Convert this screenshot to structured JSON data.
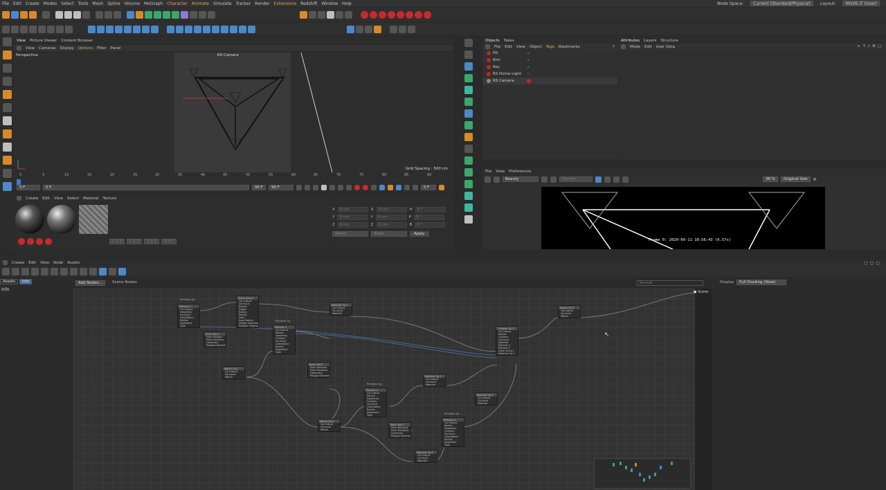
{
  "menu": [
    "File",
    "Edit",
    "Create",
    "Modes",
    "Select",
    "Tools",
    "Mesh",
    "Spline",
    "Volume",
    "MoGraph",
    "Character",
    "Animate",
    "Simulate",
    "Tracker",
    "Render",
    "Extensions",
    "Redshift",
    "Window",
    "Help"
  ],
  "menu_highlight": [
    "Character",
    "Animate",
    "Extensions"
  ],
  "node_space_label": "Node Space:",
  "node_space_value": "Current (Standard/Physical)",
  "layout_label": "Layout:",
  "layout_value": "MOVE-IT (User)",
  "viewport": {
    "tabs": [
      "View",
      "Picture Viewer",
      "Content Browser"
    ],
    "menus": [
      "View",
      "Cameras",
      "Display",
      "Options",
      "Filter",
      "Panel"
    ],
    "label": "Perspective",
    "camera": "RS Camera",
    "grid_spacing": "Grid Spacing : 500 cm"
  },
  "timeline": {
    "ticks": [
      "0",
      "5",
      "10",
      "15",
      "20",
      "25",
      "30",
      "35",
      "40",
      "45",
      "50",
      "55",
      "60",
      "65",
      "70",
      "75",
      "80",
      "85",
      "90"
    ],
    "start": "0 F",
    "current": "0 F",
    "end_a": "90 F",
    "end_b": "90 F",
    "frame_field": "0 F"
  },
  "material_panel": {
    "menus": [
      "Create",
      "Edit",
      "View",
      "Select",
      "Material",
      "Texture"
    ],
    "chips": [
      "2 1 3",
      "1 2 3",
      "3 1 2",
      "2 3 1"
    ]
  },
  "coords": {
    "rows": [
      {
        "a": "X",
        "av": "0 cm",
        "b": "X",
        "bv": "0 cm",
        "c": "H",
        "cv": "0 °"
      },
      {
        "a": "Y",
        "av": "0 cm",
        "b": "Y",
        "bv": "0 cm",
        "c": "P",
        "cv": "0 °"
      },
      {
        "a": "Z",
        "av": "0 cm",
        "b": "Z",
        "bv": "0 cm",
        "c": "B",
        "cv": "0 °"
      }
    ],
    "world": "World",
    "scale": "Scale",
    "apply": "Apply"
  },
  "objects": {
    "tabs": [
      "Objects",
      "Takes"
    ],
    "menus": [
      "File",
      "Edit",
      "View",
      "Object",
      "Tags",
      "Bookmarks"
    ],
    "items": [
      "Fill",
      "Rim",
      "Key",
      "RS Dome Light",
      "RS Camera"
    ]
  },
  "attributes": {
    "tabs": [
      "Attributes",
      "Layers",
      "Structure"
    ],
    "menus": [
      "Mode",
      "Edit",
      "User Data"
    ]
  },
  "render_view": {
    "menus": [
      "File",
      "View",
      "Preferences"
    ],
    "pass": "Beauty",
    "render_combo": "Render",
    "zoom": "38 %",
    "size": "Original Size",
    "caption": "Frame 0: 2020-09-11 10:56:43 (6.57s)"
  },
  "node_editor": {
    "menus": [
      "Create",
      "Edit",
      "View",
      "Node",
      "Assets"
    ],
    "tabs": [
      "Assets",
      "Info"
    ],
    "info_title": "Info",
    "add_nodes": "Add Nodes...",
    "scene_nodes": "Scene Nodes",
    "search_placeholder": "Reveal",
    "display_label": "Display",
    "display_value": "Full Shading (Slow)",
    "scene_port": "Scene"
  },
  "nodes": [
    {
      "title": "Platonic.1",
      "sub": "Primitive Op",
      "lines": [
        "Op Output",
        "Geometry",
        "Op Input",
        "Orientation",
        "Radius",
        "Segments",
        "Type"
      ]
    },
    {
      "title": "Atom Array.1",
      "sub": "",
      "lines": [
        "Op Output",
        "Op Input",
        "Radius",
        "Edges",
        "Radius",
        "Radius",
        "Axes",
        "Axes Radius",
        "Height Segments",
        "Rotation Segments"
      ]
    },
    {
      "title": "Material Op.2",
      "sub": "",
      "lines": [
        "Op Output",
        "Op Input",
        "Material"
      ]
    },
    {
      "title": "Point Info.1",
      "sub": "",
      "lines": [
        "Point Position",
        "Point Positions",
        "Geometry",
        "Polygon Normals"
      ]
    },
    {
      "title": "Platonic.3",
      "sub": "Primitive Op",
      "lines": [
        "Op Output",
        "Radius",
        "Geometry",
        "Children",
        "Op Input",
        "Orientation",
        "Radius",
        "Segments",
        "Type"
      ]
    },
    {
      "title": "Matrix Op.1",
      "sub": "",
      "lines": [
        "Op Output",
        "Op Input",
        "Matrix"
      ]
    },
    {
      "title": "Point Info.2",
      "sub": "",
      "lines": [
        "Point Normals",
        "Point Positions",
        "Geometry",
        "Polygon Normals"
      ]
    },
    {
      "title": "Material Op.1",
      "sub": "",
      "lines": [
        "Op Output",
        "Op Input",
        "Material"
      ]
    },
    {
      "title": "Children Op.1",
      "sub": "",
      "lines": [
        "Op Output",
        "Radius",
        "Children",
        "Op Input",
        "Material",
        "Platonic.1",
        "Platonic.3",
        "Atom Array.1",
        "Material Op.1"
      ]
    },
    {
      "title": "Platonic.2",
      "sub": "Primitive Op",
      "lines": [
        "Op Output",
        "Radius",
        "Geometry",
        "Children",
        "Op Input",
        "Orientation",
        "Radius",
        "Segments",
        "Type"
      ]
    },
    {
      "title": "Material Op.3",
      "sub": "",
      "lines": [
        "Op Output",
        "Op Input",
        "Material"
      ]
    },
    {
      "title": "Matrix Op.2",
      "sub": "",
      "lines": [
        "Op Output",
        "Op Input",
        "Matrix"
      ]
    },
    {
      "title": "Point Info.3",
      "sub": "",
      "lines": [
        "Point Normals",
        "Point Positions",
        "Geometry",
        "Polygon Normals"
      ]
    },
    {
      "title": "Material Op.4",
      "sub": "",
      "lines": [
        "Op Output",
        "Op Input",
        "Material"
      ]
    },
    {
      "title": "Platonic.4",
      "sub": "Primitive Op",
      "lines": [
        "Op Output",
        "Radius",
        "Geometry",
        "Children",
        "Op Input",
        "Orientation",
        "Radius",
        "Segments",
        "Type"
      ]
    },
    {
      "title": "Matrix Op.3",
      "sub": "",
      "lines": [
        "Op Output",
        "Op Input",
        "Matrix"
      ]
    }
  ],
  "colors": {
    "accent": "#e2a45c",
    "red_icons": "#c82424",
    "green_check": "#4cc46a",
    "active_tab": "#4b8ac9"
  }
}
